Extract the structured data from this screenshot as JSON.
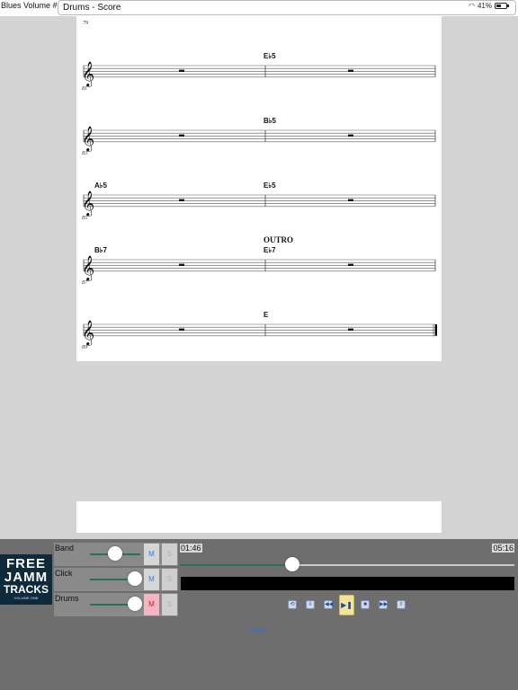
{
  "app": {
    "title": "Blues Volume #2",
    "window_title": "Drums - Score",
    "battery": "41%"
  },
  "score": {
    "systems": [
      {
        "measure": "81",
        "chords": [
          {
            "label": "E♭5",
            "slot": 1
          }
        ],
        "section": ""
      },
      {
        "measure": "83",
        "chords": [
          {
            "label": "B♭5",
            "slot": 1
          }
        ],
        "section": ""
      },
      {
        "measure": "85",
        "chords": [
          {
            "label": "A♭5",
            "slot": 0
          },
          {
            "label": "E♭5",
            "slot": 1
          }
        ],
        "section": ""
      },
      {
        "measure": "87",
        "chords": [
          {
            "label": "B♭7",
            "slot": 0
          },
          {
            "label": "E♭7",
            "slot": 1
          }
        ],
        "section": "OUTRO"
      },
      {
        "measure": "89",
        "chords": [
          {
            "label": "E",
            "slot": 1
          }
        ],
        "section": "",
        "final": true
      }
    ],
    "top_measure": "79",
    "clef_glyph": "𝄞",
    "rest_glyph": "▬"
  },
  "mixer": {
    "tracks": [
      {
        "name": "Band",
        "level": 0.5,
        "mute_label": "M",
        "solo_label": "S",
        "muted": false
      },
      {
        "name": "Click",
        "level": 0.9,
        "mute_label": "M",
        "solo_label": "S",
        "muted": false
      },
      {
        "name": "Drums",
        "level": 0.9,
        "mute_label": "M",
        "solo_label": "S",
        "muted": true
      }
    ]
  },
  "album": {
    "line1": "FREE",
    "line2": "JAMM",
    "line3": "TRACKS",
    "line4": "VOLUME ONE"
  },
  "playback": {
    "elapsed": "01:46",
    "total": "05:16",
    "progress": 0.335
  },
  "transport": [
    {
      "name": "loop-icon",
      "glyph": "⟲"
    },
    {
      "name": "skip-down-icon",
      "glyph": "⇩"
    },
    {
      "name": "rewind-icon",
      "glyph": "◀◀"
    },
    {
      "name": "play-pause-icon",
      "glyph": "▶❚"
    },
    {
      "name": "stop-icon",
      "glyph": "■"
    },
    {
      "name": "fast-forward-icon",
      "glyph": "▶▶"
    },
    {
      "name": "skip-up-icon",
      "glyph": "⇧"
    }
  ],
  "footer": {
    "link_label": "Close"
  },
  "colors": {
    "panel": "#6e6e6e",
    "slider_fill": "#2a6f5a",
    "mute_active": "#f4b6c2",
    "play_button": "#f3e49a"
  }
}
